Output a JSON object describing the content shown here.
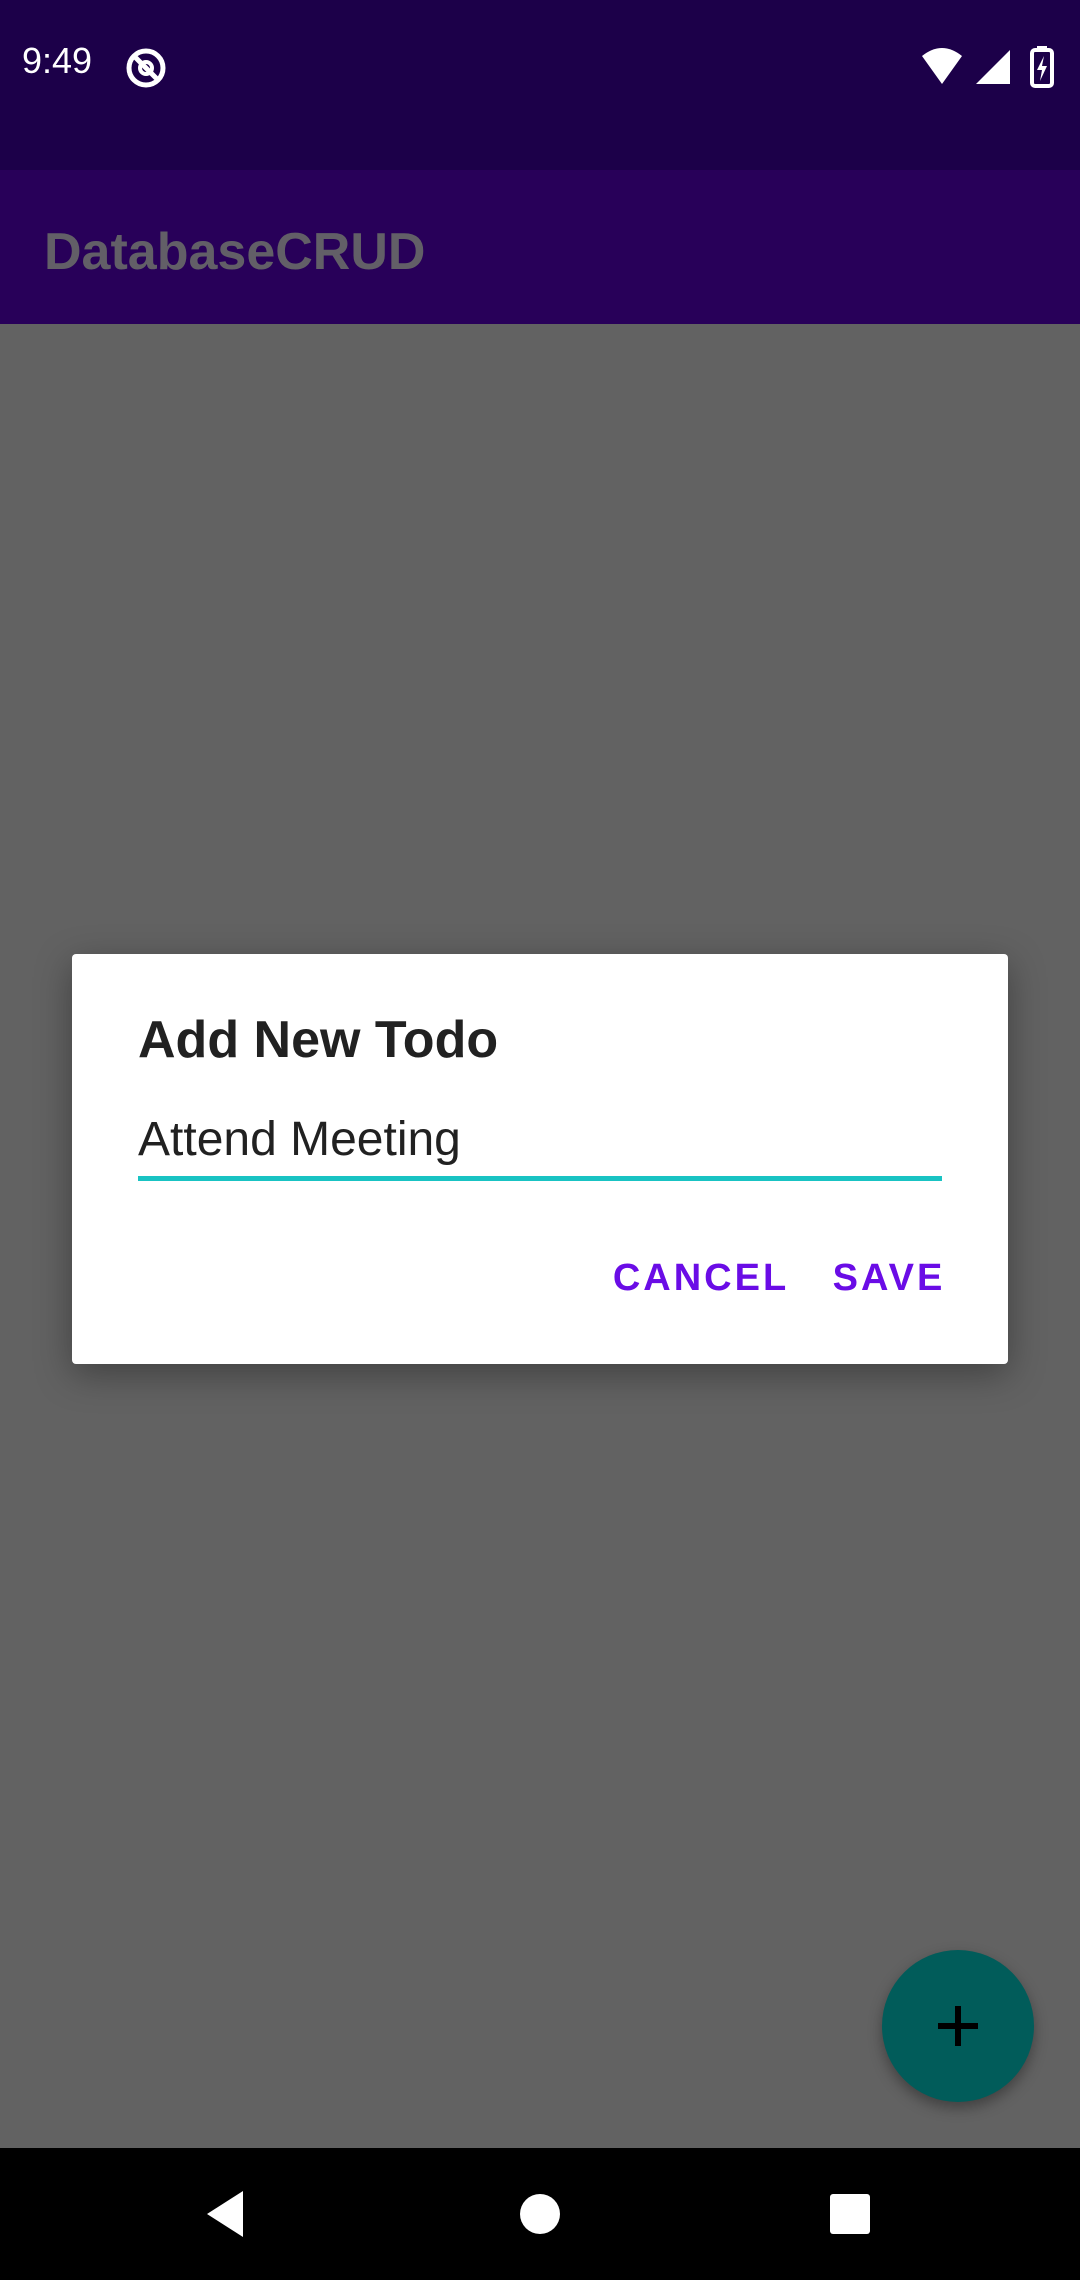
{
  "status_bar": {
    "time": "9:49",
    "app_icon": "no-disturb-icon",
    "wifi_icon": "wifi-icon",
    "signal_icon": "cell-signal-icon",
    "battery_icon": "battery-charging-icon"
  },
  "app_bar": {
    "title": "DatabaseCRUD"
  },
  "dialog": {
    "title": "Add New Todo",
    "input_value": "Attend Meeting",
    "cancel_label": "CANCEL",
    "save_label": "SAVE"
  },
  "fab": {
    "icon": "plus-icon"
  },
  "nav_bar": {
    "back_icon": "back-icon",
    "home_icon": "home-icon",
    "recents_icon": "recents-icon"
  },
  "colors": {
    "status_bar": "#1c0049",
    "app_bar": "#280059",
    "scrim": "#626262",
    "accent": "#6a0ce6",
    "input_underline": "#19c3c3",
    "fab": "#015c5a"
  }
}
